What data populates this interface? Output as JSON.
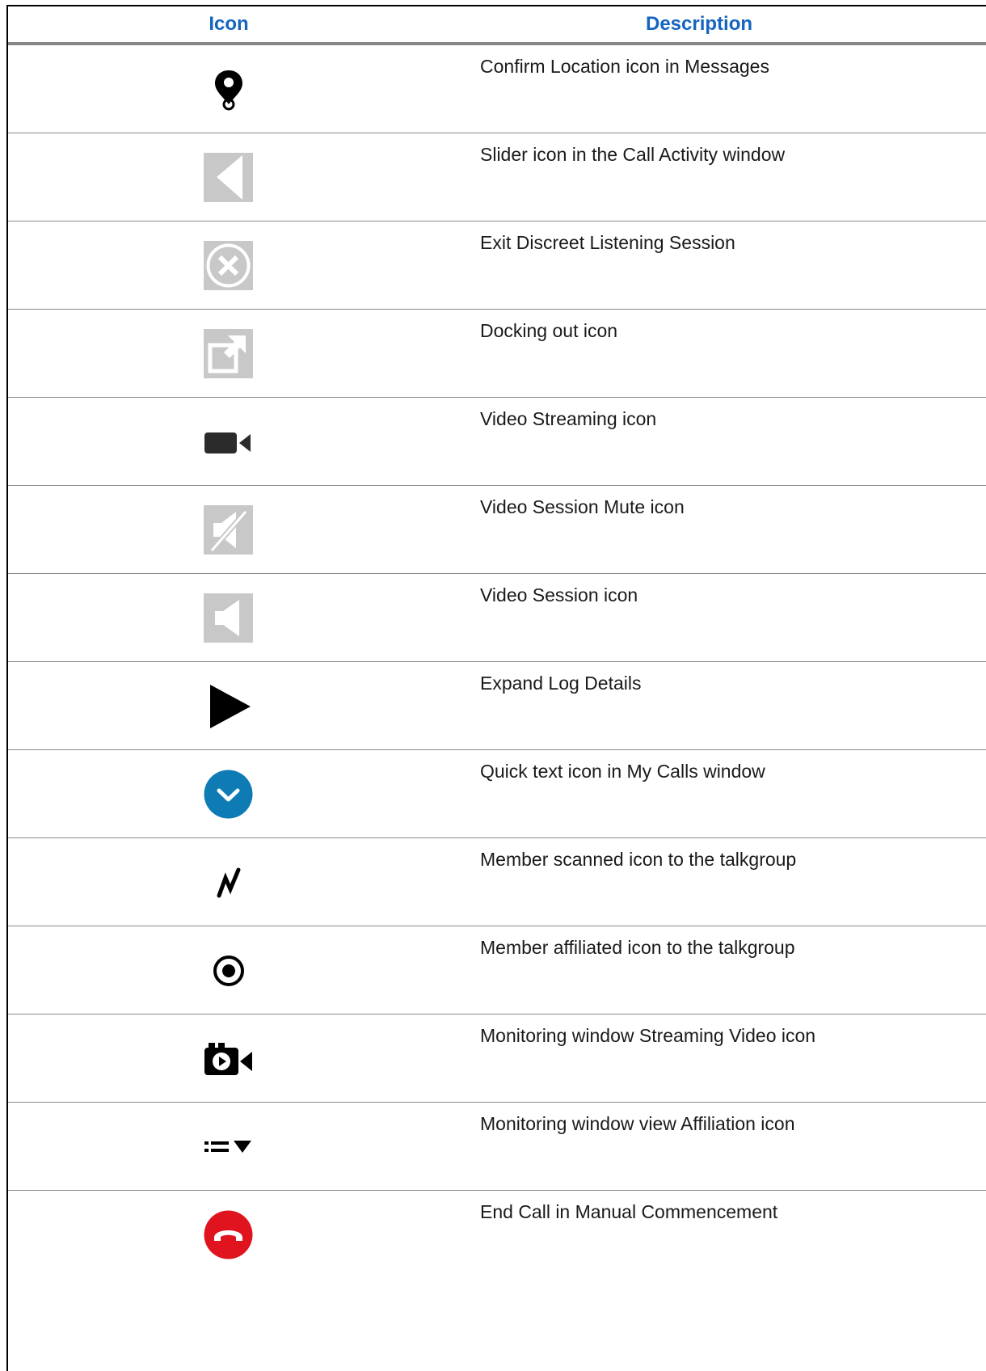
{
  "table": {
    "headers": {
      "icon": "Icon",
      "description": "Description"
    },
    "rows": [
      {
        "icon": "location-pin-icon",
        "description": "Confirm Location icon in Messages"
      },
      {
        "icon": "slider-left-icon",
        "description": "Slider icon in the Call Activity window"
      },
      {
        "icon": "exit-circle-x-icon",
        "description": "Exit Discreet Listening Session"
      },
      {
        "icon": "dock-out-icon",
        "description": "Docking out icon"
      },
      {
        "icon": "video-camera-icon",
        "description": "Video Streaming icon"
      },
      {
        "icon": "speaker-muted-icon",
        "description": "Video Session Mute icon"
      },
      {
        "icon": "speaker-icon",
        "description": "Video Session icon"
      },
      {
        "icon": "play-triangle-icon",
        "description": "Expand Log Details"
      },
      {
        "icon": "chevron-down-circle-icon",
        "description": "Quick text icon in My Calls window"
      },
      {
        "icon": "scan-zigzag-icon",
        "description": "Member scanned icon to the talkgroup"
      },
      {
        "icon": "target-dot-icon",
        "description": "Member affiliated icon to the talkgroup"
      },
      {
        "icon": "streaming-camera-icon",
        "description": "Monitoring window Streaming Video icon"
      },
      {
        "icon": "list-dropdown-icon",
        "description": "Monitoring window view Affiliation icon"
      },
      {
        "icon": "end-call-icon",
        "description": "End Call in Manual Commencement"
      }
    ]
  },
  "colors": {
    "header_text": "#1565c0",
    "icon_grey_bg": "#c8c8c8",
    "quick_text_blue": "#0e7bb5",
    "end_call_red": "#e0141e"
  }
}
